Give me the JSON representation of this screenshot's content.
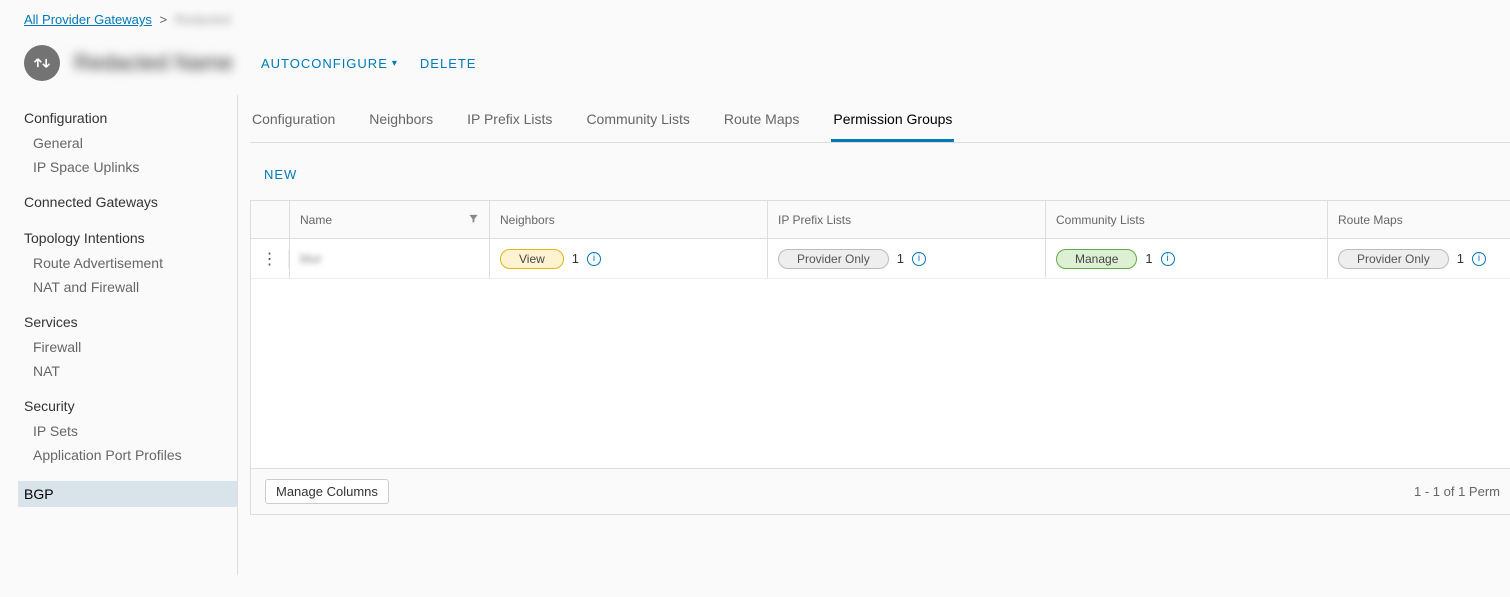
{
  "breadcrumb": {
    "root": "All Provider Gateways",
    "current": "Redacted"
  },
  "header": {
    "gateway_name": "Redacted Name",
    "autoconfigure": "AUTOCONFIGURE",
    "delete": "DELETE"
  },
  "sidebar": {
    "sections": [
      {
        "title": "Configuration",
        "items": [
          "General",
          "IP Space Uplinks"
        ]
      },
      {
        "title": "Connected Gateways",
        "items": []
      },
      {
        "title": "Topology Intentions",
        "items": [
          "Route Advertisement",
          "NAT and Firewall"
        ]
      },
      {
        "title": "Services",
        "items": [
          "Firewall",
          "NAT"
        ]
      },
      {
        "title": "Security",
        "items": [
          "IP Sets",
          "Application Port Profiles"
        ]
      }
    ],
    "bgp": "BGP"
  },
  "tabs": [
    "Configuration",
    "Neighbors",
    "IP Prefix Lists",
    "Community Lists",
    "Route Maps",
    "Permission Groups"
  ],
  "active_tab": 5,
  "toolbar": {
    "new": "NEW"
  },
  "grid": {
    "columns": [
      "Name",
      "Neighbors",
      "IP Prefix Lists",
      "Community Lists",
      "Route Maps"
    ],
    "row": {
      "name": "blur",
      "neighbors": {
        "badge": "View",
        "count": "1"
      },
      "prefix": {
        "badge": "Provider Only",
        "count": "1"
      },
      "community": {
        "badge": "Manage",
        "count": "1"
      },
      "route": {
        "badge": "Provider Only",
        "count": "1"
      }
    },
    "manage_columns": "Manage Columns",
    "pager": "1 - 1 of 1 Perm"
  }
}
